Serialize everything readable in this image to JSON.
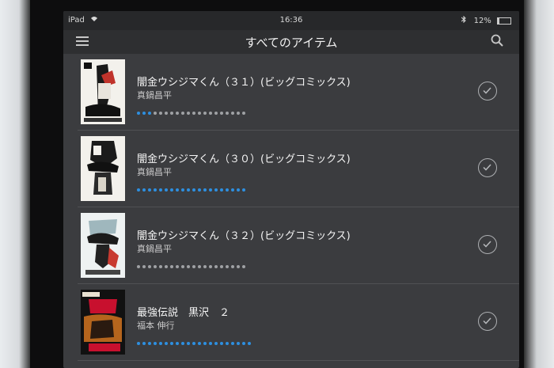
{
  "status_bar": {
    "device": "iPad",
    "time": "16:36",
    "battery": "12%"
  },
  "nav": {
    "title": "すべてのアイテム",
    "menu_icon": "hamburger-menu-icon",
    "search_icon": "search-icon"
  },
  "items": [
    {
      "title": "闇金ウシジマくん（３１）(ビッグコミックス)",
      "author": "真鍋昌平",
      "read_dots": 3,
      "total_dots": 20
    },
    {
      "title": "闇金ウシジマくん（３０）(ビッグコミックス)",
      "author": "真鍋昌平",
      "read_dots": 20,
      "total_dots": 20
    },
    {
      "title": "闇金ウシジマくん（３２）(ビッグコミックス)",
      "author": "真鍋昌平",
      "read_dots": 0,
      "total_dots": 20
    },
    {
      "title": "最強伝説　黒沢　２",
      "author": "福本 伸行",
      "read_dots": 21,
      "total_dots": 21
    }
  ],
  "colors": {
    "accent": "#2e8fe0",
    "unread_dot": "#9fa1a4",
    "background": "#3b3c3f"
  }
}
